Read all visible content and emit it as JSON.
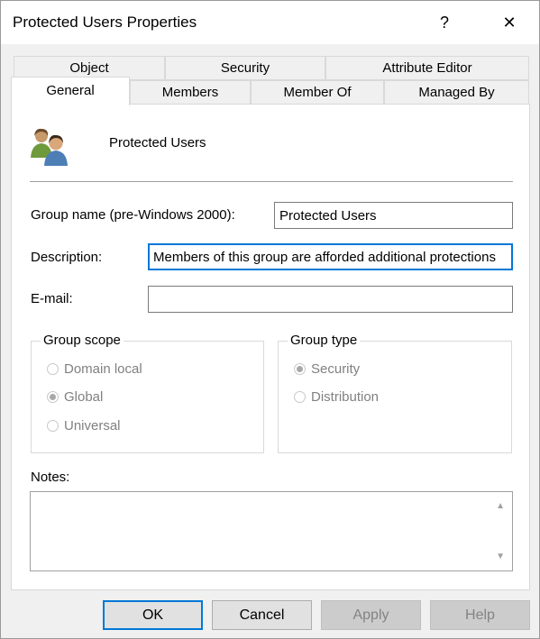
{
  "window": {
    "title": "Protected Users Properties",
    "help_glyph": "?",
    "close_glyph": "✕"
  },
  "tabs": {
    "row1": [
      "Object",
      "Security",
      "Attribute Editor"
    ],
    "row2": [
      "General",
      "Members",
      "Member Of",
      "Managed By"
    ],
    "active": "General"
  },
  "header": {
    "group_display_name": "Protected Users",
    "icon": "users-group-icon"
  },
  "fields": {
    "group_name_label": "Group name (pre-Windows 2000):",
    "group_name_value": "Protected Users",
    "description_label": "Description:",
    "description_value": "Members of this group are afforded additional protections",
    "email_label": "E-mail:",
    "email_value": ""
  },
  "group_scope": {
    "title": "Group scope",
    "options": [
      "Domain local",
      "Global",
      "Universal"
    ],
    "selected": "Global"
  },
  "group_type": {
    "title": "Group type",
    "options": [
      "Security",
      "Distribution"
    ],
    "selected": "Security"
  },
  "notes": {
    "label": "Notes:",
    "value": ""
  },
  "buttons": {
    "ok": "OK",
    "cancel": "Cancel",
    "apply": "Apply",
    "help": "Help"
  },
  "colors": {
    "focus_accent": "#0078d7",
    "disabled_text": "#838383"
  }
}
